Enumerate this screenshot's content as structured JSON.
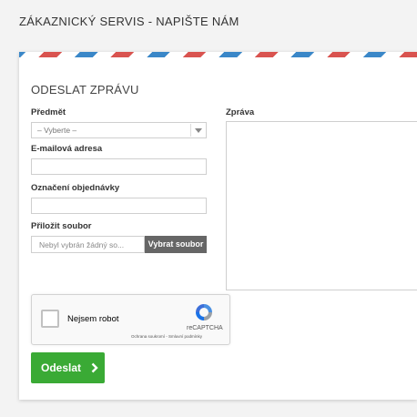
{
  "page": {
    "title": "ZÁKAZNICKÝ SERVIS - NAPIŠTE NÁM"
  },
  "form": {
    "heading": "ODESLAT ZPRÁVU",
    "subject": {
      "label": "Předmět",
      "selected": "– Vyberte –"
    },
    "email": {
      "label": "E-mailová adresa",
      "value": ""
    },
    "order": {
      "label": "Označení objednávky",
      "value": ""
    },
    "attachment": {
      "label": "Přiložit soubor",
      "file_status": "Nebyl vybrán žádný so...",
      "button_label": "Vybrat soubor"
    },
    "message": {
      "label": "Zpráva",
      "value": ""
    },
    "recaptcha": {
      "checkbox_label": "Nejsem robot",
      "brand": "reCAPTCHA",
      "links": "Ochrana soukromí - Smluvní podmínky"
    },
    "submit": {
      "label": "Odeslat"
    }
  },
  "icons": {
    "recaptcha_logo": "recaptcha-logo-icon",
    "submit_arrow": "chevron-right-icon",
    "select_arrow": "caret-down-icon"
  },
  "colors": {
    "submit_bg": "#3aaa35",
    "airmail_red": "#d9534f",
    "airmail_blue": "#3a87c8"
  }
}
